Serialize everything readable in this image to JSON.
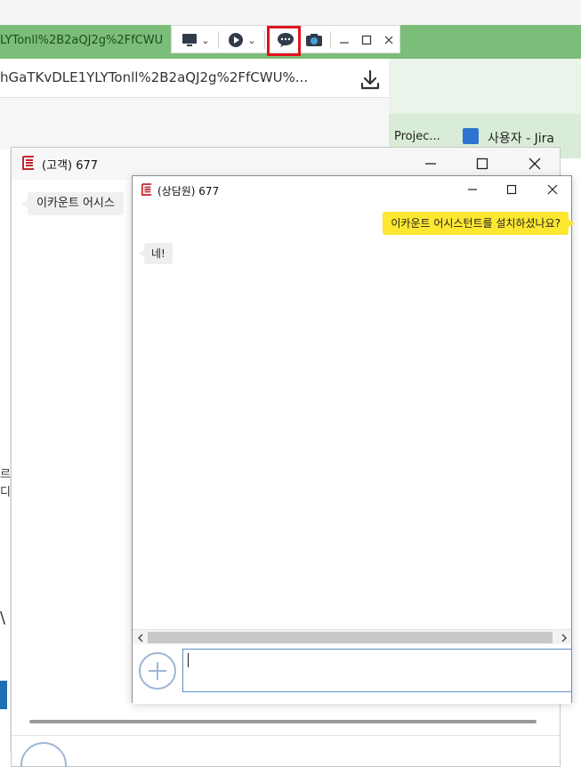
{
  "browser": {
    "tab_url_partial": "LYTonll%2B2aQJ2g%2FfCWU",
    "address_text": "hGaTKvDLE1YLYTonll%2B2aQJ2g%2FfCWU%...",
    "bookmarks": [
      {
        "label": "Projec..."
      },
      {
        "label": "사용자 - Jira"
      }
    ],
    "left_fragment_1": "르",
    "left_fragment_2": "디",
    "left_fragment_3": "\\"
  },
  "toolbar": {
    "screen_icon": "monitor-icon",
    "record_icon": "play-circle-icon",
    "chat_icon": "chat-bubble-icon",
    "camera_icon": "camera-icon",
    "chevron": "⌄"
  },
  "customer_window": {
    "title": "(고객) 677",
    "bubble_text": "이카운트 어시스"
  },
  "agent_window": {
    "title": "(상담원) 677",
    "messages": [
      {
        "side": "right",
        "text": "이카운트 어시스턴트를 설치하셨나요?"
      },
      {
        "side": "left",
        "text": "네!"
      }
    ],
    "input_value": ""
  },
  "colors": {
    "accent_green": "#7cbd7a",
    "bubble_yellow": "#fde731",
    "highlight_red": "#e0131d",
    "input_border": "#5b8fc7"
  }
}
